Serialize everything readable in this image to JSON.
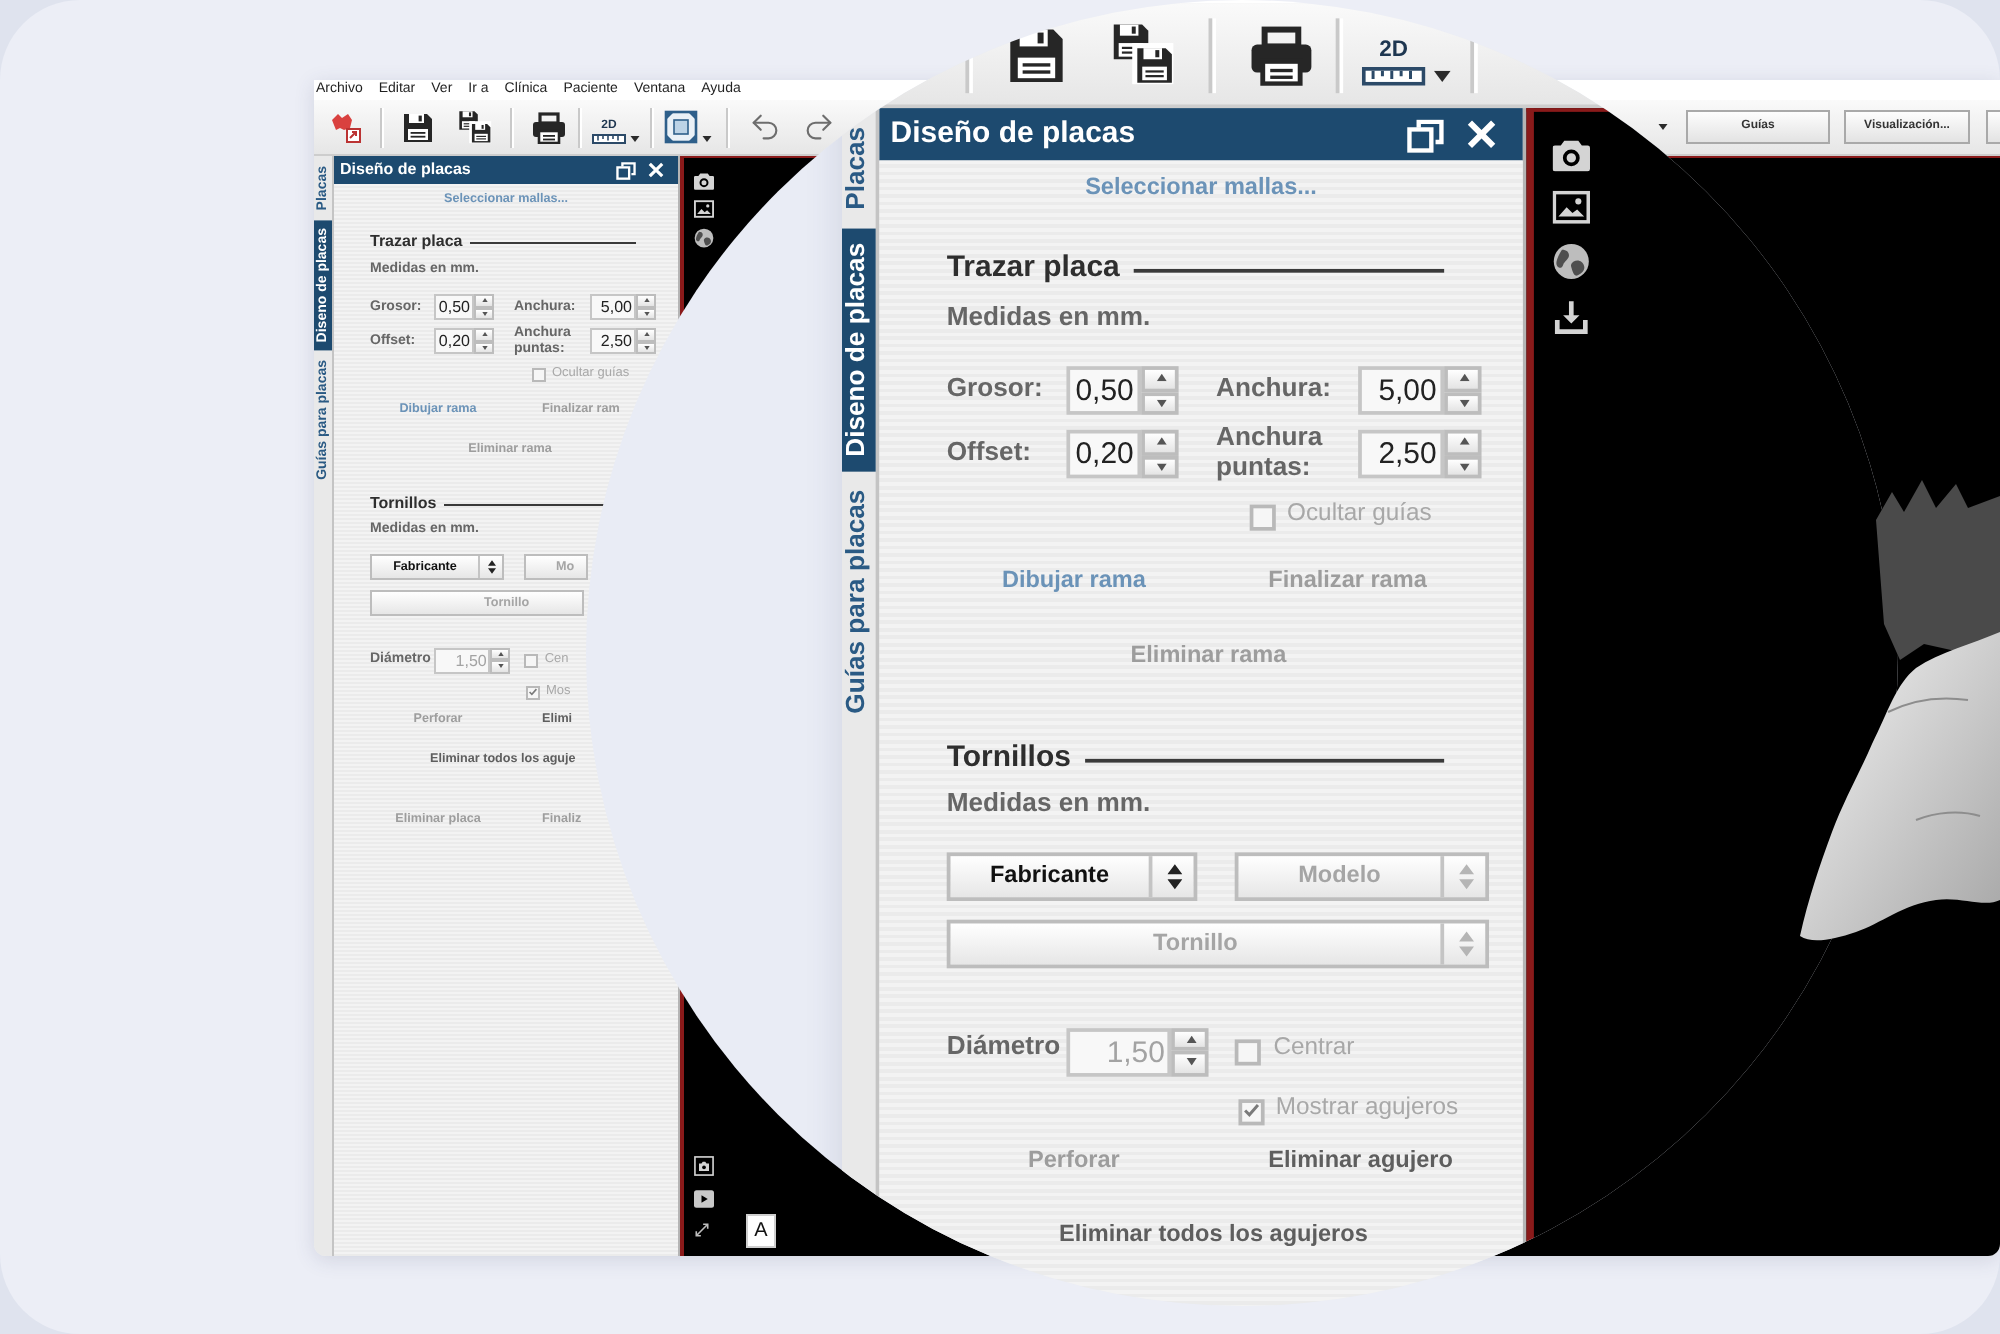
{
  "screen": {
    "menu": [
      "Archivo",
      "Editar",
      "Ver",
      "Ir a",
      "Clínica",
      "Paciente",
      "Ventana",
      "Ayuda"
    ],
    "toolbar": {
      "ruler_label": "2D",
      "buttons": [
        "Guías",
        "Visualización..."
      ]
    },
    "side_tabs": [
      {
        "label": "Placas",
        "selected": false
      },
      {
        "label": "Diseno de placas",
        "selected": true
      },
      {
        "label": "Guías para placas",
        "selected": false
      }
    ],
    "panel": {
      "title": "Diseño de placas",
      "select_meshes": {
        "label": "Seleccionar mallas...",
        "highlighted": true,
        "disabled": false
      },
      "trace": {
        "heading": "Trazar placa",
        "units": "Medidas en mm.",
        "fields": [
          {
            "label": "Grosor:",
            "value": "0,50"
          },
          {
            "label": "Anchura:",
            "value": "5,00"
          },
          {
            "label": "Offset:",
            "value": "0,20"
          },
          {
            "label": "Anchura puntas:",
            "value": "2,50"
          }
        ],
        "hide_guides": {
          "label": "Ocultar guías",
          "checked": false,
          "disabled": true
        },
        "actions": [
          {
            "label": "Dibujar rama",
            "highlighted": true,
            "disabled": false
          },
          {
            "label": "Finalizar ram",
            "highlighted": false,
            "disabled": true
          }
        ],
        "remove": {
          "label": "Eliminar rama",
          "highlighted": false,
          "disabled": true
        }
      },
      "screws": {
        "heading": "Tornillos",
        "units": "Medidas en mm.",
        "selects": [
          {
            "label": "Fabricante",
            "disabled": false
          },
          {
            "label": "Mo",
            "disabled": true
          }
        ],
        "screw_select": {
          "label": "Tornillo",
          "disabled": true
        },
        "diameter": {
          "label": "Diámetro",
          "value": "1,50",
          "disabled": true
        },
        "center": {
          "label": "Cen",
          "checked": false,
          "disabled": true
        },
        "show_holes": {
          "label": "Mos",
          "checked": true,
          "disabled": true
        },
        "actions": [
          {
            "label": "Perforar",
            "highlighted": false,
            "disabled": true
          },
          {
            "label": "Elimi",
            "highlighted": false,
            "disabled": false
          }
        ],
        "remove_all": {
          "label": "Eliminar todos los aguje",
          "highlighted": false,
          "disabled": false
        }
      },
      "footer_actions": [
        {
          "label": "Eliminar placa",
          "highlighted": false,
          "disabled": true
        },
        {
          "label": "Finaliz",
          "highlighted": false,
          "disabled": true
        }
      ]
    },
    "viewport": {
      "text_tool": "A"
    }
  },
  "magnifier": {
    "toolbar": {
      "ruler_label": "2D"
    },
    "side_tabs": [
      {
        "label": "Placas",
        "selected": false
      },
      {
        "label": "Diseno de placas",
        "selected": true
      },
      {
        "label": "Guías para placas",
        "selected": false
      }
    ],
    "panel": {
      "title": "Diseño de placas",
      "select_meshes": {
        "label": "Seleccionar mallas...",
        "highlighted": true,
        "disabled": false
      },
      "trace": {
        "heading": "Trazar placa",
        "units": "Medidas en mm.",
        "fields": [
          {
            "label": "Grosor:",
            "value": "0,50"
          },
          {
            "label": "Anchura:",
            "value": "5,00"
          },
          {
            "label": "Offset:",
            "value": "0,20"
          },
          {
            "label": "Anchura puntas:",
            "value": "2,50"
          }
        ],
        "hide_guides": {
          "label": "Ocultar guías",
          "checked": false,
          "disabled": true
        },
        "actions": [
          {
            "label": "Dibujar rama",
            "highlighted": true,
            "disabled": false
          },
          {
            "label": "Finalizar rama",
            "highlighted": false,
            "disabled": true
          }
        ],
        "remove": {
          "label": "Eliminar rama",
          "highlighted": false,
          "disabled": true
        }
      },
      "screws": {
        "heading": "Tornillos",
        "units": "Medidas en mm.",
        "selects": [
          {
            "label": "Fabricante",
            "disabled": false
          },
          {
            "label": "Modelo",
            "disabled": true
          }
        ],
        "screw_select": {
          "label": "Tornillo",
          "disabled": true
        },
        "diameter": {
          "label": "Diámetro",
          "value": "1,50",
          "disabled": true
        },
        "center": {
          "label": "Centrar",
          "checked": false,
          "disabled": true
        },
        "show_holes": {
          "label": "Mostrar agujeros",
          "checked": true,
          "disabled": true
        },
        "actions": [
          {
            "label": "Perforar",
            "highlighted": false,
            "disabled": true
          },
          {
            "label": "Eliminar agujero",
            "highlighted": false,
            "disabled": false
          }
        ],
        "remove_all": {
          "label": "Eliminar todos los agujeros",
          "highlighted": false,
          "disabled": false
        }
      }
    }
  }
}
